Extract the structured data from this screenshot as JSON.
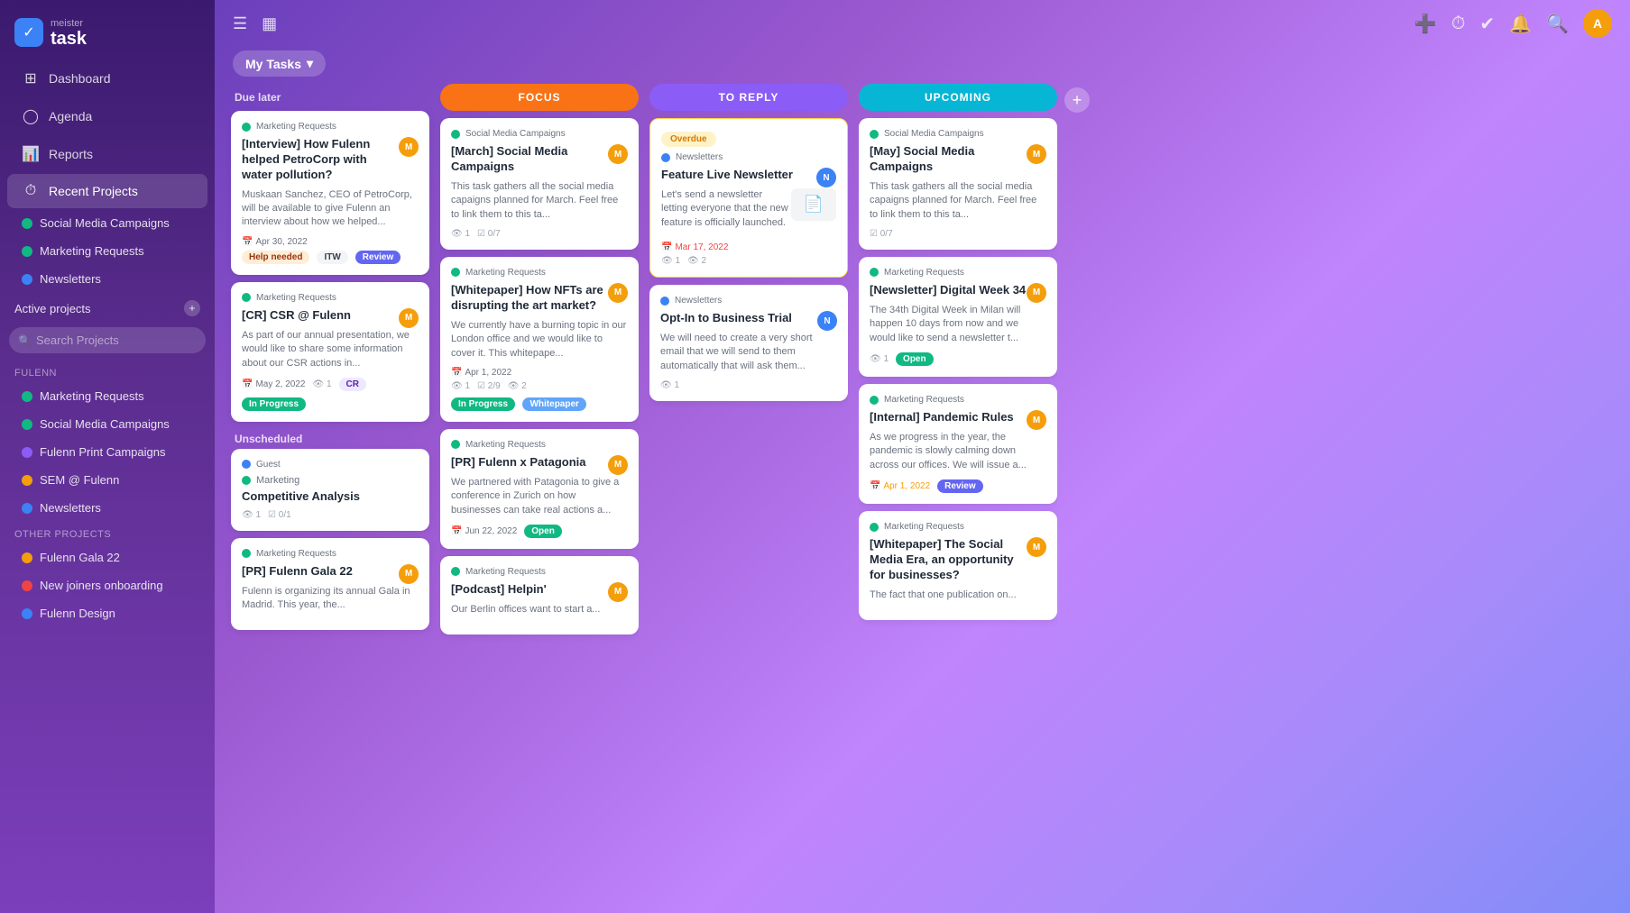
{
  "sidebar": {
    "logo": {
      "meister": "meister",
      "task": "task"
    },
    "nav": [
      {
        "id": "dashboard",
        "label": "Dashboard",
        "icon": "⊞"
      },
      {
        "id": "agenda",
        "label": "Agenda",
        "icon": "◯"
      },
      {
        "id": "reports",
        "label": "Reports",
        "icon": "📊"
      }
    ],
    "recent_projects_label": "Recent Projects",
    "recent_projects": [
      {
        "id": "social-media",
        "label": "Social Media Campaigns",
        "color": "#10b981"
      },
      {
        "id": "marketing",
        "label": "Marketing Requests",
        "color": "#10b981"
      },
      {
        "id": "newsletters",
        "label": "Newsletters",
        "color": "#3b82f6"
      }
    ],
    "active_projects_label": "Active projects",
    "search_placeholder": "Search Projects",
    "fulenn_label": "FULENN",
    "fulenn_projects": [
      {
        "id": "marketing-req",
        "label": "Marketing Requests",
        "color": "#10b981"
      },
      {
        "id": "social-campaigns",
        "label": "Social Media Campaigns",
        "color": "#10b981"
      },
      {
        "id": "print-campaigns",
        "label": "Fulenn Print Campaigns",
        "color": "#8b5cf6"
      },
      {
        "id": "sem",
        "label": "SEM @ Fulenn",
        "color": "#f59e0b"
      },
      {
        "id": "newsletters-f",
        "label": "Newsletters",
        "color": "#3b82f6"
      }
    ],
    "other_projects_label": "OTHER PROJECTS",
    "other_projects": [
      {
        "id": "gala22",
        "label": "Fulenn Gala 22",
        "color": "#f59e0b"
      },
      {
        "id": "new-joiners",
        "label": "New joiners onboarding",
        "color": "#ef4444"
      },
      {
        "id": "design",
        "label": "Fulenn Design",
        "color": "#3b82f6"
      }
    ]
  },
  "topbar": {
    "my_tasks_label": "My Tasks",
    "icons": [
      "➕",
      "⏱",
      "✓",
      "🔔",
      "🔍"
    ]
  },
  "columns": {
    "due_later_label": "Due later",
    "unscheduled_label": "Unscheduled",
    "focus_label": "FOCUS",
    "toreply_label": "TO REPLY",
    "upcoming_label": "UPCOMING"
  },
  "due_later_cards": [
    {
      "project": "Marketing Requests",
      "project_color": "#10b981",
      "title": "[Interview] How Fulenn helped PetroCorp with water pollution?",
      "desc": "Muskaan Sanchez, CEO of PetroCorp, will be available to give Fulenn an interview about how we helped...",
      "date": "Apr 30, 2022",
      "date_type": "normal",
      "tags": [
        "Help needed",
        "ITW",
        "Review"
      ],
      "has_avatar": true
    },
    {
      "project": "Marketing Requests",
      "project_color": "#10b981",
      "title": "[CR] CSR @ Fulenn",
      "desc": "As part of our annual presentation, we would like to share some information about our CSR actions in...",
      "date": "May 2, 2022",
      "date_type": "normal",
      "tags": [
        "In Progress"
      ],
      "tag_special": "CR",
      "watchers": "1",
      "has_avatar": true
    }
  ],
  "unscheduled_cards": [
    {
      "project": "Guest",
      "project_color": "#3b82f6",
      "sub_project": "Marketing",
      "title": "Competitive Analysis",
      "watchers": "1",
      "checklist": "0/1",
      "has_avatar": false
    },
    {
      "project": "Marketing Requests",
      "project_color": "#10b981",
      "title": "[PR] Fulenn Gala 22",
      "desc": "Fulenn is organizing its annual Gala in Madrid. This year, the...",
      "has_avatar": true
    }
  ],
  "focus_cards": [
    {
      "project": "Social Media Campaigns",
      "project_color": "#10b981",
      "title": "[March] Social Media Campaigns",
      "desc": "This task gathers all the social media capaigns planned for March. Feel free to link them to this ta...",
      "watchers": "1",
      "checklist": "0/7",
      "has_avatar": true
    },
    {
      "project": "Marketing Requests",
      "project_color": "#10b981",
      "title": "[Whitepaper] How NFTs are disrupting the art market?",
      "desc": "We currently have a burning topic in our London office and we would like to cover it. This whitepape...",
      "date": "Apr 1, 2022",
      "tags": [
        "In Progress",
        "Whitepaper"
      ],
      "watchers": "1",
      "checklist": "2/9",
      "eyes": "2",
      "has_avatar": true
    },
    {
      "project": "Marketing Requests",
      "project_color": "#10b981",
      "title": "[PR] Fulenn x Patagonia",
      "desc": "We partnered with Patagonia to give a conference in Zurich on how businesses can take real actions a...",
      "date": "Jun 22, 2022",
      "tags": [
        "Open"
      ],
      "has_avatar": true
    },
    {
      "project": "Marketing Requests",
      "project_color": "#10b981",
      "title": "[Podcast] Helpin'",
      "desc": "Our Berlin offices want to start a...",
      "has_avatar": true
    }
  ],
  "toreply_cards": [
    {
      "overdue": true,
      "project": "Newsletters",
      "project_color": "#3b82f6",
      "title": "Feature Live Newsletter",
      "desc": "Let's send a newsletter letting everyone that the new feature is officially launched.",
      "date": "Mar 17, 2022",
      "date_type": "overdue",
      "watchers": "1",
      "eyes": "2",
      "has_attachment": true,
      "has_avatar": true
    },
    {
      "project": "Newsletters",
      "project_color": "#3b82f6",
      "title": "Opt-In to Business Trial",
      "desc": "We will need to create a very short email that we will send to them automatically that will ask them...",
      "watchers": "1",
      "has_avatar": true
    }
  ],
  "upcoming_cards": [
    {
      "project": "Social Media Campaigns",
      "project_color": "#10b981",
      "title": "[May] Social Media Campaigns",
      "desc": "This task gathers all the social media capaigns planned for March. Feel free to link them to this ta...",
      "checklist": "0/7",
      "has_avatar": true
    },
    {
      "project": "Marketing Requests",
      "project_color": "#10b981",
      "title": "[Newsletter] Digital Week 34",
      "desc": "The 34th Digital Week in Milan will happen 10 days from now and we would like to send a newsletter t...",
      "watchers": "1",
      "tags": [
        "Open"
      ],
      "has_avatar": true
    },
    {
      "project": "Marketing Requests",
      "project_color": "#10b981",
      "title": "[Internal] Pandemic Rules",
      "desc": "As we progress in the year, the pandemic is slowly calming down across our offices. We will issue a...",
      "date": "Apr 1, 2022",
      "date_type": "orange",
      "tags": [
        "Review"
      ],
      "has_avatar": true
    },
    {
      "project": "Marketing Requests",
      "project_color": "#10b981",
      "title": "[Whitepaper] The Social Media Era, an opportunity for businesses?",
      "desc": "The fact that one publication on...",
      "has_avatar": true
    }
  ]
}
